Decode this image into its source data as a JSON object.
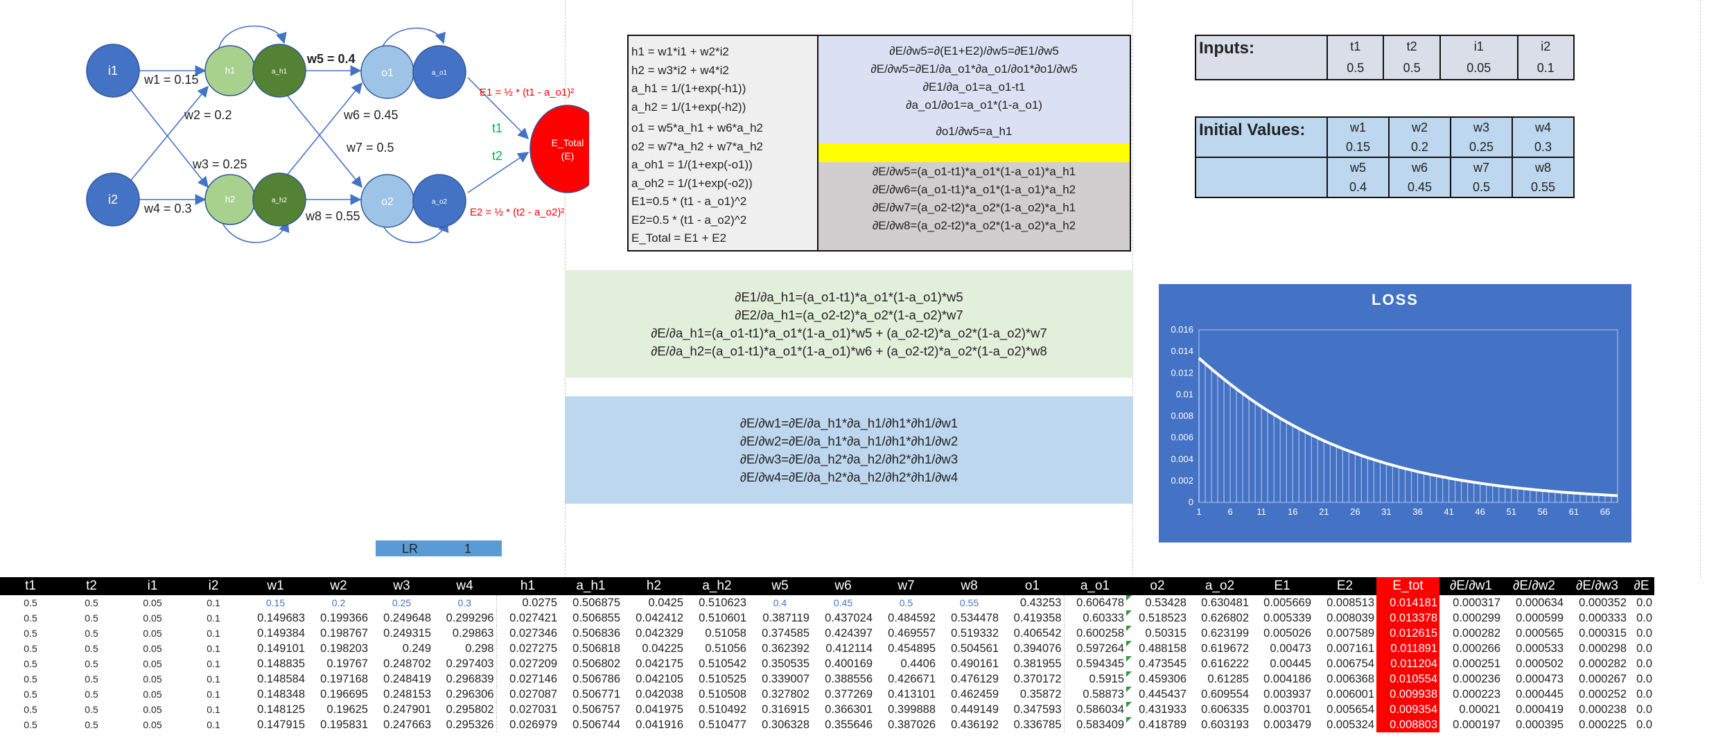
{
  "network": {
    "nodes": {
      "i1": "i1",
      "i2": "i2",
      "h1": "h1",
      "h2": "h2",
      "a_h1": "a_h1",
      "a_h2": "a_h2",
      "o1": "o1",
      "o2": "o2",
      "a_o1": "a_o1",
      "a_o2": "a_o2",
      "e_total_1": "E_Total",
      "e_total_2": "(E)"
    },
    "weights": {
      "w1": "w1 = 0.15",
      "w2": "w2 = 0.2",
      "w3": "w3 = 0.25",
      "w4": "w4 = 0.3",
      "w5": "w5 = 0.4",
      "w6": "w6 = 0.45",
      "w7": "w7 = 0.5",
      "w8": "w8 = 0.55"
    },
    "errors": {
      "e1": "E1 = ½ * (t1 - a_o1)²",
      "e2": "E2 = ½ * (t2 - a_o2)²"
    },
    "targets": {
      "t1": "t1",
      "t2": "t2"
    },
    "colors": {
      "input_node": "#4472c4",
      "hidden_node": "#a9d18e",
      "hidden_act": "#548235",
      "output_node": "#9dc3e6",
      "output_act": "#4472c4",
      "error_node": "#ff0000",
      "error_text": "#ff0000",
      "target_text": "#00b050"
    }
  },
  "formulas": {
    "left": [
      "h1 = w1*i1 + w2*i2",
      "h2 = w3*i2 + w4*i2",
      "a_h1 = 1/(1+exp(-h1))",
      "a_h2 = 1/(1+exp(-h2))",
      "o1 = w5*a_h1 + w6*a_h2",
      "o2 = w7*a_h2 + w7*a_h2",
      "a_oh1 = 1/(1+exp(-o1))",
      "a_oh2 = 1/(1+exp(-o2))",
      "E1=0.5 * (t1 - a_o1)^2",
      "E2=0.5 * (t1 - a_o2)^2",
      "E_Total = E1 + E2"
    ],
    "right_top": [
      "∂E/∂w5=∂(E1+E2)/∂w5=∂E1/∂w5",
      "∂E/∂w5=∂E1/∂a_o1*∂a_o1/∂o1*∂o1/∂w5",
      "∂E1/∂a_o1=a_o1-t1",
      "∂a_o1/∂o1=a_o1*(1-a_o1)",
      "∂o1/∂w5=a_h1"
    ],
    "right_bottom": [
      "∂E/∂w5=(a_o1-t1)*a_o1*(1-a_o1)*a_h1",
      "∂E/∂w6=(a_o1-t1)*a_o1*(1-a_o1)*a_h2",
      "∂E/∂w7=(a_o2-t2)*a_o2*(1-a_o2)*a_h1",
      "∂E/∂w8=(a_o2-t2)*a_o2*(1-a_o2)*a_h2"
    ]
  },
  "inputs": {
    "title": "Inputs:",
    "labels": [
      "t1",
      "t2",
      "i1",
      "i2"
    ],
    "values": [
      "0.5",
      "0.5",
      "0.05",
      "0.1"
    ]
  },
  "initial_values": {
    "title": "Initial Values:",
    "labels1": [
      "w1",
      "w2",
      "w3",
      "w4"
    ],
    "values1": [
      "0.15",
      "0.2",
      "0.25",
      "0.3"
    ],
    "labels2": [
      "w5",
      "w6",
      "w7",
      "w8"
    ],
    "values2": [
      "0.4",
      "0.45",
      "0.5",
      "0.55"
    ]
  },
  "green_panel": [
    "∂E1/∂a_h1=(a_o1-t1)*a_o1*(1-a_o1)*w5",
    "∂E2/∂a_h1=(a_o2-t2)*a_o2*(1-a_o2)*w7",
    "∂E/∂a_h1=(a_o1-t1)*a_o1*(1-a_o1)*w5 + (a_o2-t2)*a_o2*(1-a_o2)*w7",
    "∂E/∂a_h2=(a_o1-t1)*a_o1*(1-a_o1)*w6 + (a_o2-t2)*a_o2*(1-a_o2)*w8"
  ],
  "blue_panel": [
    "∂E/∂w1=∂E/∂a_h1*∂a_h1/∂h1*∂h1/∂w1",
    "∂E/∂w2=∂E/∂a_h1*∂a_h1/∂h1*∂h1/∂w2",
    "∂E/∂w3=∂E/∂a_h2*∂a_h2/∂h2*∂h1/∂w3",
    "∂E/∂w4=∂E/∂a_h2*∂a_h2/∂h2*∂h1/∂w4"
  ],
  "lr": {
    "label": "LR",
    "value": "1"
  },
  "chart_data": {
    "type": "area",
    "title": "LOSS",
    "x": [
      1,
      2,
      3,
      4,
      5,
      6,
      7,
      8,
      9,
      10,
      11,
      12,
      13,
      14,
      15,
      16,
      17,
      18,
      19,
      20,
      21,
      22,
      23,
      24,
      25,
      26,
      27,
      28,
      29,
      30,
      31,
      32,
      33,
      34,
      35,
      36,
      37,
      38,
      39,
      40,
      41,
      42,
      43,
      44,
      45,
      46,
      47,
      48,
      49,
      50,
      51,
      52,
      53,
      54,
      55,
      56,
      57,
      58,
      59,
      60,
      61,
      62,
      63,
      64,
      65,
      66,
      67,
      68
    ],
    "values": [
      0.01337,
      0.01287,
      0.01237,
      0.01189,
      0.01142,
      0.01096,
      0.01052,
      0.01009,
      0.00967,
      0.00927,
      0.00888,
      0.00851,
      0.00815,
      0.0078,
      0.00747,
      0.00715,
      0.00684,
      0.00654,
      0.00625,
      0.00598,
      0.00571,
      0.00546,
      0.00522,
      0.00498,
      0.00476,
      0.00455,
      0.00434,
      0.00414,
      0.00396,
      0.00378,
      0.0036,
      0.00344,
      0.00328,
      0.00313,
      0.00299,
      0.00285,
      0.00272,
      0.00259,
      0.00247,
      0.00236,
      0.00225,
      0.00214,
      0.00204,
      0.00195,
      0.00186,
      0.00177,
      0.00169,
      0.00161,
      0.00153,
      0.00146,
      0.00139,
      0.00133,
      0.00127,
      0.00121,
      0.00115,
      0.0011,
      0.00105,
      0.001,
      0.00095,
      0.00091,
      0.00087,
      0.00083,
      0.00079,
      0.00075,
      0.00072,
      0.00068,
      0.00065,
      0.00062
    ],
    "x_ticks": [
      "1",
      "6",
      "11",
      "16",
      "21",
      "26",
      "31",
      "36",
      "41",
      "46",
      "51",
      "56",
      "61",
      "66"
    ],
    "y_ticks": [
      "0",
      "0.002",
      "0.004",
      "0.006",
      "0.008",
      "0.01",
      "0.012",
      "0.014",
      "0.016"
    ],
    "ylim": [
      0,
      0.016
    ],
    "colors": {
      "background": "#4472c4",
      "line": "#ffffff"
    }
  },
  "table": {
    "headers": [
      "t1",
      "t2",
      "i1",
      "i2",
      "w1",
      "w2",
      "w3",
      "w4",
      "h1",
      "a_h1",
      "h2",
      "a_h2",
      "w5",
      "w6",
      "w7",
      "w8",
      "o1",
      "a_o1",
      "o2",
      "a_o2",
      "E1",
      "E2",
      "E_tot",
      "∂E/∂w1",
      "∂E/∂w2",
      "∂E/∂w3",
      "∂E"
    ],
    "rows": [
      [
        "0.5",
        "0.5",
        "0.05",
        "0.1",
        "0.15",
        "0.2",
        "0.25",
        "0.3",
        "0.0275",
        "0.506875",
        "0.0425",
        "0.510623",
        "0.4",
        "0.45",
        "0.5",
        "0.55",
        "0.43253",
        "0.606478",
        "0.53428",
        "0.630481",
        "0.005669",
        "0.008513",
        "0.014181",
        "0.000317",
        "0.000634",
        "0.000352",
        "0.0"
      ],
      [
        "0.5",
        "0.5",
        "0.05",
        "0.1",
        "0.149683",
        "0.199366",
        "0.249648",
        "0.299296",
        "0.027421",
        "0.506855",
        "0.042412",
        "0.510601",
        "0.387119",
        "0.437024",
        "0.484592",
        "0.534478",
        "0.419358",
        "0.60333",
        "0.518523",
        "0.626802",
        "0.005339",
        "0.008039",
        "0.013378",
        "0.000299",
        "0.000599",
        "0.000333",
        "0.0"
      ],
      [
        "0.5",
        "0.5",
        "0.05",
        "0.1",
        "0.149384",
        "0.198767",
        "0.249315",
        "0.29863",
        "0.027346",
        "0.506836",
        "0.042329",
        "0.51058",
        "0.374585",
        "0.424397",
        "0.469557",
        "0.519332",
        "0.406542",
        "0.600258",
        "0.50315",
        "0.623199",
        "0.005026",
        "0.007589",
        "0.012615",
        "0.000282",
        "0.000565",
        "0.000315",
        "0.0"
      ],
      [
        "0.5",
        "0.5",
        "0.05",
        "0.1",
        "0.149101",
        "0.198203",
        "0.249",
        "0.298",
        "0.027275",
        "0.506818",
        "0.04225",
        "0.51056",
        "0.362392",
        "0.412114",
        "0.454895",
        "0.504561",
        "0.394076",
        "0.597264",
        "0.488158",
        "0.619672",
        "0.00473",
        "0.007161",
        "0.011891",
        "0.000266",
        "0.000533",
        "0.000298",
        "0.0"
      ],
      [
        "0.5",
        "0.5",
        "0.05",
        "0.1",
        "0.148835",
        "0.19767",
        "0.248702",
        "0.297403",
        "0.027209",
        "0.506802",
        "0.042175",
        "0.510542",
        "0.350535",
        "0.400169",
        "0.4406",
        "0.490161",
        "0.381955",
        "0.594345",
        "0.473545",
        "0.616222",
        "0.00445",
        "0.006754",
        "0.011204",
        "0.000251",
        "0.000502",
        "0.000282",
        "0.0"
      ],
      [
        "0.5",
        "0.5",
        "0.05",
        "0.1",
        "0.148584",
        "0.197168",
        "0.248419",
        "0.296839",
        "0.027146",
        "0.506786",
        "0.042105",
        "0.510525",
        "0.339007",
        "0.388556",
        "0.426671",
        "0.476129",
        "0.370172",
        "0.5915",
        "0.459306",
        "0.61285",
        "0.004186",
        "0.006368",
        "0.010554",
        "0.000236",
        "0.000473",
        "0.000267",
        "0.0"
      ],
      [
        "0.5",
        "0.5",
        "0.05",
        "0.1",
        "0.148348",
        "0.196695",
        "0.248153",
        "0.296306",
        "0.027087",
        "0.506771",
        "0.042038",
        "0.510508",
        "0.327802",
        "0.377269",
        "0.413101",
        "0.462459",
        "0.35872",
        "0.58873",
        "0.445437",
        "0.609554",
        "0.003937",
        "0.006001",
        "0.009938",
        "0.000223",
        "0.000445",
        "0.000252",
        "0.0"
      ],
      [
        "0.5",
        "0.5",
        "0.05",
        "0.1",
        "0.148125",
        "0.19625",
        "0.247901",
        "0.295802",
        "0.027031",
        "0.506757",
        "0.041975",
        "0.510492",
        "0.316915",
        "0.366301",
        "0.399888",
        "0.449149",
        "0.347593",
        "0.586034",
        "0.431933",
        "0.606335",
        "0.003701",
        "0.005654",
        "0.009354",
        "0.00021",
        "0.000419",
        "0.000238",
        "0.0"
      ],
      [
        "0.5",
        "0.5",
        "0.05",
        "0.1",
        "0.147915",
        "0.195831",
        "0.247663",
        "0.295326",
        "0.026979",
        "0.506744",
        "0.041916",
        "0.510477",
        "0.306328",
        "0.355646",
        "0.387026",
        "0.436192",
        "0.336785",
        "0.583409",
        "0.418789",
        "0.603193",
        "0.003479",
        "0.005324",
        "0.008803",
        "0.000197",
        "0.000395",
        "0.000225",
        "0.0"
      ]
    ]
  }
}
